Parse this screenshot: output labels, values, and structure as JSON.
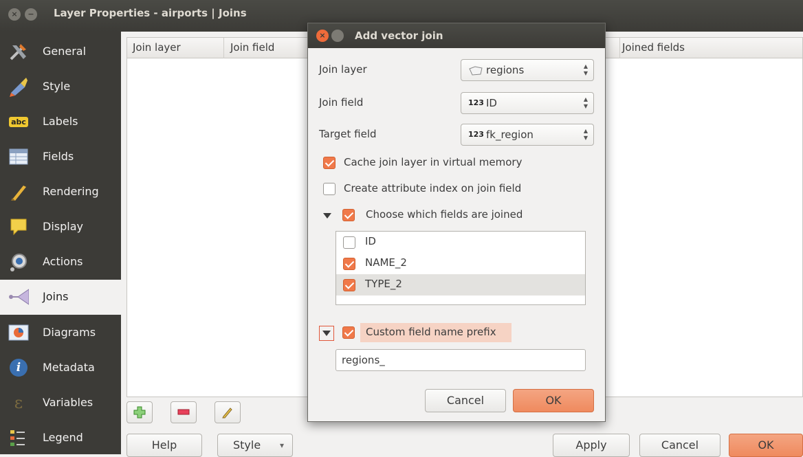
{
  "window": {
    "title": "Layer Properties - airports | Joins",
    "close_glyph": "×",
    "min_glyph": "−"
  },
  "sidebar": {
    "items": [
      {
        "label": "General",
        "icon": "general-icon"
      },
      {
        "label": "Style",
        "icon": "style-icon"
      },
      {
        "label": "Labels",
        "icon": "labels-icon",
        "icon_text": "abc"
      },
      {
        "label": "Fields",
        "icon": "fields-icon"
      },
      {
        "label": "Rendering",
        "icon": "rendering-icon"
      },
      {
        "label": "Display",
        "icon": "display-icon"
      },
      {
        "label": "Actions",
        "icon": "actions-icon"
      },
      {
        "label": "Joins",
        "icon": "joins-icon"
      },
      {
        "label": "Diagrams",
        "icon": "diagrams-icon"
      },
      {
        "label": "Metadata",
        "icon": "metadata-icon",
        "icon_text": "i"
      },
      {
        "label": "Variables",
        "icon": "variables-icon",
        "icon_text": "ε"
      },
      {
        "label": "Legend",
        "icon": "legend-icon"
      }
    ],
    "active": "Joins"
  },
  "table": {
    "columns": [
      "Join layer",
      "Join field",
      "Joined fields"
    ]
  },
  "toolbar": {
    "add_icon": "add-icon",
    "remove_icon": "remove-icon",
    "edit_icon": "edit-icon"
  },
  "buttons": {
    "help": "Help",
    "style": "Style",
    "style_arrow": "▾",
    "apply": "Apply",
    "cancel": "Cancel",
    "ok": "OK"
  },
  "dialog": {
    "title": "Add vector join",
    "join_layer_label": "Join layer",
    "join_layer_value": "regions",
    "join_field_label": "Join field",
    "join_field_value": "ID",
    "join_field_type": "123",
    "target_field_label": "Target field",
    "target_field_value": "fk_region",
    "target_field_type": "123",
    "cache_label": "Cache join layer in virtual memory",
    "cache_checked": true,
    "index_label": "Create attribute index on join field",
    "index_checked": false,
    "choose_label": "Choose which fields are joined",
    "choose_checked": true,
    "fields": [
      {
        "name": "ID",
        "checked": false
      },
      {
        "name": "NAME_2",
        "checked": true
      },
      {
        "name": "TYPE_2",
        "checked": true
      }
    ],
    "prefix_label": "Custom field name prefix",
    "prefix_checked": true,
    "prefix_value": "regions_",
    "cancel_label": "Cancel",
    "ok_label": "OK",
    "accent_color": "#f0794a"
  }
}
